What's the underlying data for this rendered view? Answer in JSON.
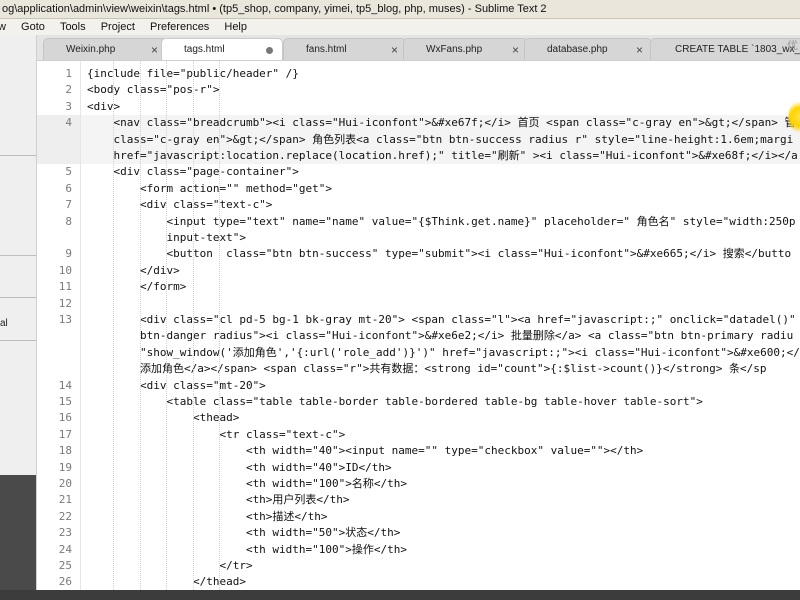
{
  "window": {
    "title": "og\\application\\admin\\view\\weixin\\tags.html • (tp5_shop, company, yimei, tp5_blog, php, muses) - Sublime Text 2"
  },
  "menu": [
    "w",
    "Goto",
    "Tools",
    "Project",
    "Preferences",
    "Help"
  ],
  "sidebar": {
    "partial_labels": [
      "al"
    ]
  },
  "tabs": [
    {
      "label": "Weixin.php",
      "state": "close"
    },
    {
      "label": "tags.html",
      "state": "modified"
    },
    {
      "label": "fans.html",
      "state": "close"
    },
    {
      "label": "WxFans.php",
      "state": "close"
    },
    {
      "label": "database.php",
      "state": "close"
    },
    {
      "label": "CREATE TABLE `1803_wx_fans`",
      "state": "none"
    }
  ],
  "overlay_text": "优",
  "editor": {
    "highlight_row": 3,
    "rows": [
      {
        "n": "1",
        "text": "{include file=\"public/header\" /}"
      },
      {
        "n": "2",
        "text": "<body class=\"pos-r\">"
      },
      {
        "n": "3",
        "text": "<div>"
      },
      {
        "n": "4",
        "text": "    <nav class=\"breadcrumb\"><i class=\"Hui-iconfont\">&#xe67f;</i> 首页 <span class=\"c-gray en\">&gt;</span> 管"
      },
      {
        "n": "",
        "text": "    class=\"c-gray en\">&gt;</span> 角色列表<a class=\"btn btn-success radius r\" style=\"line-height:1.6em;margi"
      },
      {
        "n": "",
        "text": "    href=\"javascript:location.replace(location.href);\" title=\"刷新\" ><i class=\"Hui-iconfont\">&#xe68f;</i></a"
      },
      {
        "n": "5",
        "text": "    <div class=\"page-container\">"
      },
      {
        "n": "6",
        "text": "        <form action=\"\" method=\"get\">"
      },
      {
        "n": "7",
        "text": "        <div class=\"text-c\">"
      },
      {
        "n": "8",
        "text": "            <input type=\"text\" name=\"name\" value=\"{$Think.get.name}\" placeholder=\" 角色名\" style=\"width:250p"
      },
      {
        "n": "",
        "text": "            input-text\">"
      },
      {
        "n": "9",
        "text": "            <button  class=\"btn btn-success\" type=\"submit\"><i class=\"Hui-iconfont\">&#xe665;</i> 搜索</butto"
      },
      {
        "n": "10",
        "text": "        </div>"
      },
      {
        "n": "11",
        "text": "        </form>"
      },
      {
        "n": "12",
        "text": ""
      },
      {
        "n": "13",
        "text": "        <div class=\"cl pd-5 bg-1 bk-gray mt-20\"> <span class=\"l\"><a href=\"javascript:;\" onclick=\"datadel()\" c"
      },
      {
        "n": "",
        "text": "        btn-danger radius\"><i class=\"Hui-iconfont\">&#xe6e2;</i> 批量删除</a> <a class=\"btn btn-primary radiu"
      },
      {
        "n": "",
        "text": "        \"show_window('添加角色','{:url('role_add')}')\" href=\"javascript:;\"><i class=\"Hui-iconfont\">&#xe600;</"
      },
      {
        "n": "",
        "text": "        添加角色</a></span> <span class=\"r\">共有数据：<strong id=\"count\">{:$list->count()}</strong> 条</sp"
      },
      {
        "n": "14",
        "text": "        <div class=\"mt-20\">"
      },
      {
        "n": "15",
        "text": "            <table class=\"table table-border table-bordered table-bg table-hover table-sort\">"
      },
      {
        "n": "16",
        "text": "                <thead>"
      },
      {
        "n": "17",
        "text": "                    <tr class=\"text-c\">"
      },
      {
        "n": "18",
        "text": "                        <th width=\"40\"><input name=\"\" type=\"checkbox\" value=\"\"></th>"
      },
      {
        "n": "19",
        "text": "                        <th width=\"40\">ID</th>"
      },
      {
        "n": "20",
        "text": "                        <th width=\"100\">名称</th>"
      },
      {
        "n": "21",
        "text": "                        <th>用户列表</th>"
      },
      {
        "n": "22",
        "text": "                        <th>描述</th>"
      },
      {
        "n": "23",
        "text": "                        <th width=\"50\">状态</th>"
      },
      {
        "n": "24",
        "text": "                        <th width=\"100\">操作</th>"
      },
      {
        "n": "25",
        "text": "                    </tr>"
      },
      {
        "n": "26",
        "text": "                </thead>"
      }
    ]
  }
}
